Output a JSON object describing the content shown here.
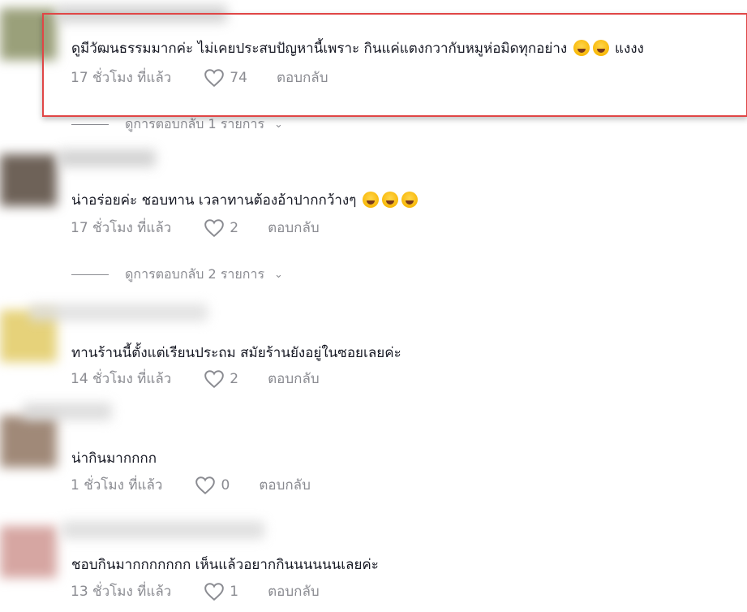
{
  "comments": [
    {
      "text": "ดูมีวัฒนธรรมมากค่ะ ไม่เคยประสบปัญหานี้เพราะ กินแค่แตงกวากับหมูห่อมิดทุกอย่าง",
      "text_tail": "แงงง",
      "time": "17 ชั่วโมง ที่แล้ว",
      "likes": "74",
      "reply": "ตอบกลับ",
      "thread": "ดูการตอบกลับ 1 รายการ"
    },
    {
      "text": "น่าอร่อยค่ะ ชอบทาน เวลาทานต้องอ้าปากกว้างๆ",
      "time": "17 ชั่วโมง ที่แล้ว",
      "likes": "2",
      "reply": "ตอบกลับ",
      "thread": "ดูการตอบกลับ 2 รายการ"
    },
    {
      "text": "ทานร้านนี้ตั้งแต่เรียนประถม สมัยร้านยังอยู่ในซอยเลยค่ะ",
      "time": "14 ชั่วโมง ที่แล้ว",
      "likes": "2",
      "reply": "ตอบกลับ"
    },
    {
      "text": "น่ากินมากกกก",
      "time": "1 ชั่วโมง ที่แล้ว",
      "likes": "0",
      "reply": "ตอบกลับ"
    },
    {
      "text": "ชอบกินมากกกกกกก เห็นแล้วอยากกินนนนนนเลยค่ะ",
      "time": "13 ชั่วโมง ที่แล้ว",
      "likes": "1",
      "reply": "ตอบกลับ"
    }
  ],
  "colors": {
    "highlight": "#e04646",
    "muted": "#8a8b91",
    "text": "#161823"
  },
  "icons": {
    "like": "heart-outline-icon",
    "expand": "chevron-down-icon",
    "emoji": "laughing-emoji-icon"
  }
}
